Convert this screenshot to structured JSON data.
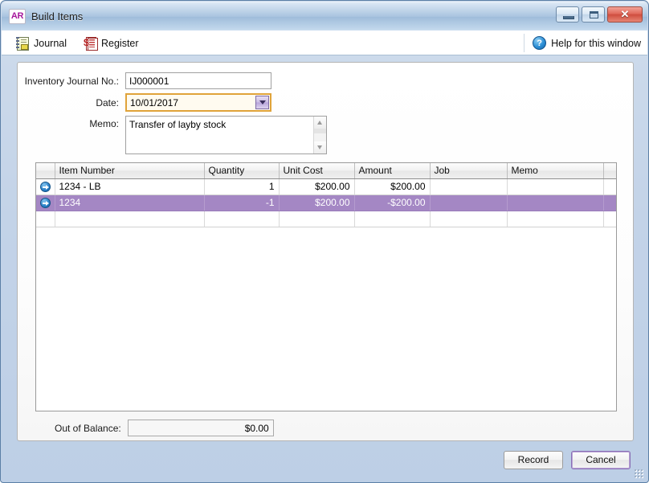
{
  "window": {
    "title": "Build Items",
    "app_badge": "AR",
    "controls": {
      "minimize": "Minimize",
      "maximize": "Maximize",
      "close": "Close",
      "close_glyph": "✕"
    }
  },
  "toolbar": {
    "journal_label": "Journal",
    "register_label": "Register",
    "help_label": "Help for this window",
    "help_glyph": "?"
  },
  "form": {
    "journal_no_label": "Inventory Journal No.:",
    "journal_no_value": "IJ000001",
    "date_label": "Date:",
    "date_value": "10/01/2017",
    "memo_label": "Memo:",
    "memo_value": "Transfer of layby stock"
  },
  "grid": {
    "columns": [
      "",
      "Item Number",
      "Quantity",
      "Unit Cost",
      "Amount",
      "Job",
      "Memo",
      ""
    ],
    "rows": [
      {
        "marker": "row-arrow",
        "item_number": "1234 - LB",
        "quantity": "1",
        "unit_cost": "$200.00",
        "amount": "$200.00",
        "job": "",
        "memo": "",
        "trailing": "",
        "selected": false
      },
      {
        "marker": "row-arrow",
        "item_number": "1234",
        "quantity": "-1",
        "unit_cost": "$200.00",
        "amount": "-$200.00",
        "job": "",
        "memo": "",
        "trailing": "",
        "selected": true
      },
      {
        "marker": "",
        "item_number": "",
        "quantity": "",
        "unit_cost": "",
        "amount": "",
        "job": "",
        "memo": "",
        "trailing": "",
        "selected": false
      }
    ]
  },
  "totals": {
    "out_of_balance_label": "Out of Balance:",
    "out_of_balance_value": "$0.00"
  },
  "footer": {
    "record_label": "Record",
    "cancel_label": "Cancel"
  },
  "colors": {
    "selection": "#a487c4",
    "accent_purple": "#a6179b",
    "focus_orange": "#e0a33a",
    "titlebar_blue": "#a9c4df"
  }
}
